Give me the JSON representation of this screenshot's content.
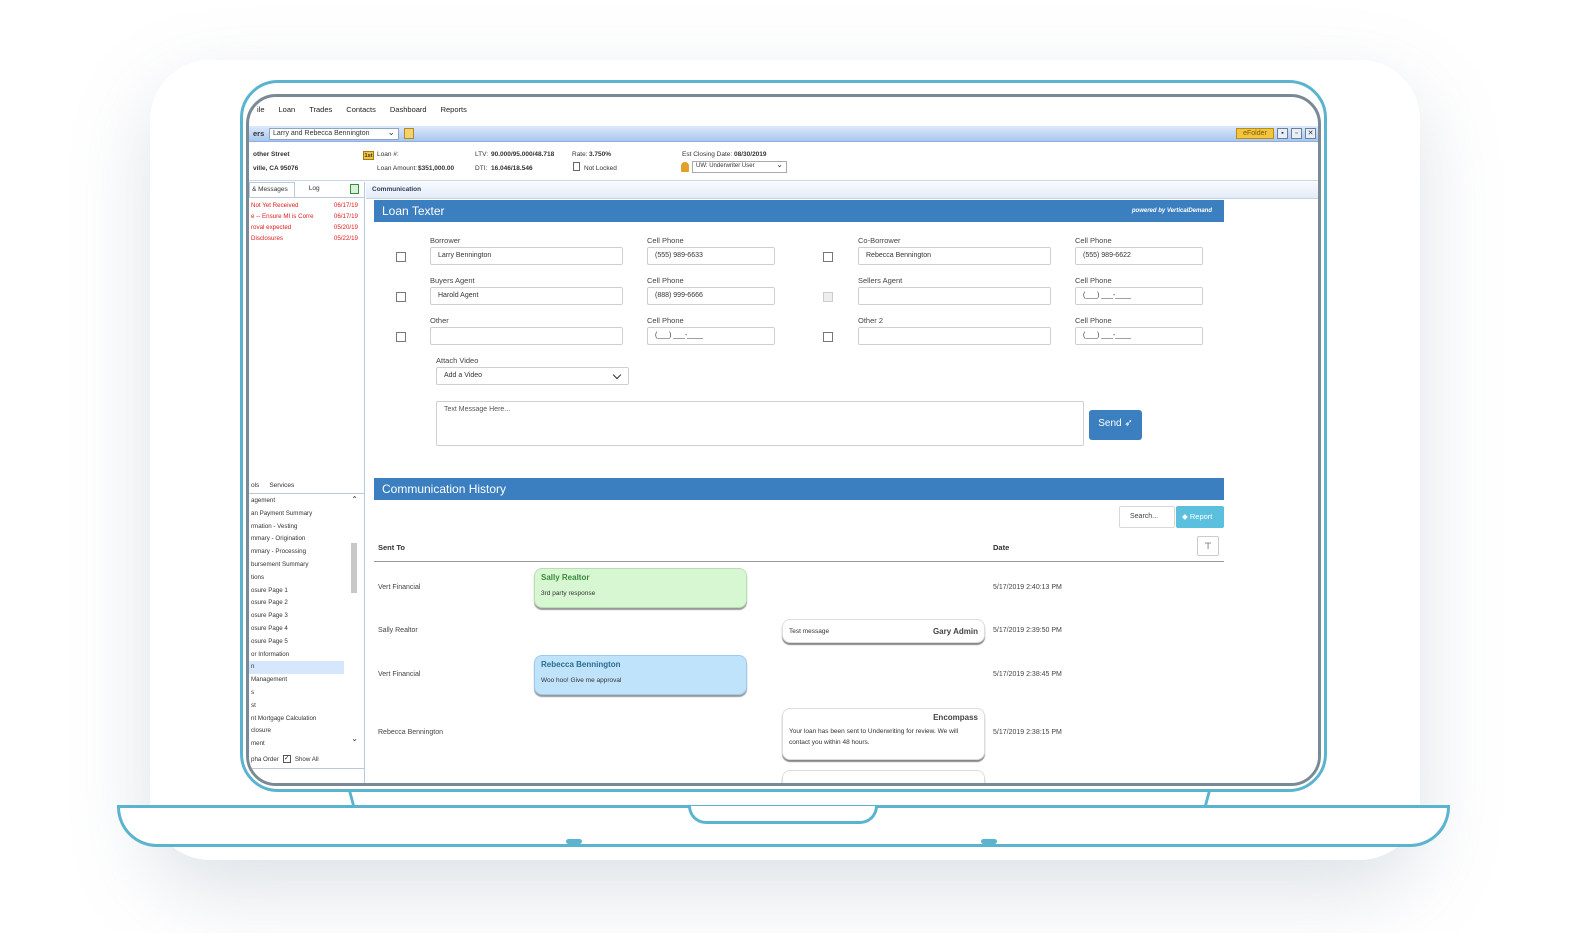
{
  "menu": [
    "ile",
    "Loan",
    "Trades",
    "Contacts",
    "Dashboard",
    "Reports"
  ],
  "titlebar": {
    "label": "ers",
    "borrower_select": "Larry and Rebecca Bennington",
    "efolder": "eFolder"
  },
  "info": {
    "street": "other Street",
    "city": "ville, CA 95076",
    "lien": "1st",
    "loan_num_label": "Loan #:",
    "loan_amount_label": "Loan Amount:",
    "loan_amount": "$351,000.00",
    "ltv_label": "LTV:",
    "ltv": "90.000/95.000/48.718",
    "dti_label": "DTI:",
    "dti": "16.046/18.546",
    "rate_label": "Rate:",
    "rate": "3.750%",
    "lock": "Not Locked",
    "closing_label": "Est Closing Date:",
    "closing_date": "08/30/2019",
    "underwriter": "UW: Underwriter User"
  },
  "left": {
    "tabs": [
      "& Messages",
      "Log"
    ],
    "messages": [
      {
        "text": "Not Yet Received",
        "date": "06/17/19"
      },
      {
        "text": "e -- Ensure MI is Corre",
        "date": "06/17/19"
      },
      {
        "text": "roval expected",
        "date": "05/20/19"
      },
      {
        "text": "Disclosures",
        "date": "05/22/19"
      }
    ],
    "tabs2": [
      "ols",
      "Services"
    ],
    "nav": [
      "agement",
      "an Payment Summary",
      "rmation - Vesting",
      "mmary - Origination",
      "mmary - Processing",
      "bursement Summary",
      "tions",
      "osure Page 1",
      "osure Page 2",
      "osure Page 3",
      "osure Page 4",
      "osure Page 5",
      "or Information",
      "n",
      "Management",
      "s",
      "st",
      "nt Mortgage Calculation",
      "closure",
      "ment"
    ],
    "alpha_order": "pha Order",
    "show_all": "Show All"
  },
  "main": {
    "tab": "Communication",
    "texter_title": "Loan Texter",
    "powered_by": "powered by VerticalDemand",
    "borrower_label": "Borrower",
    "borrower": "Larry Bennington",
    "cell_label": "Cell Phone",
    "borrower_cell": "(555) 989-6633",
    "coborrower_label": "Co-Borrower",
    "coborrower": "Rebecca Bennington",
    "coborrower_cell": "(555) 989-6622",
    "buyers_agent_label": "Buyers Agent",
    "buyers_agent": "Harold Agent",
    "buyers_agent_cell": "(888) 999-6666",
    "sellers_agent_label": "Sellers Agent",
    "empty_phone": "(___) ___-____",
    "other_label": "Other",
    "other2_label": "Other 2",
    "attach_video_label": "Attach Video",
    "add_video": "Add a Video",
    "text_placeholder": "Text Message Here...",
    "send": "Send",
    "history_title": "Communication History",
    "search": "Search...",
    "report": "Report",
    "col_sent_to": "Sent To",
    "col_date": "Date",
    "rows": [
      {
        "sent_to": "Vert Financial",
        "name": "Sally Realtor",
        "msg": "3rd party response",
        "date": "5/17/2019 2:40:13 PM"
      },
      {
        "sent_to": "Sally Realtor",
        "name": "Gary Admin",
        "msg": "Test message",
        "date": "5/17/2019 2:39:50 PM"
      },
      {
        "sent_to": "Vert Financial",
        "name": "Rebecca Bennington",
        "msg": "Woo hoo! Give me approval",
        "date": "5/17/2019 2:38:45 PM"
      },
      {
        "sent_to": "Rebecca Bennington",
        "name": "Encompass",
        "msg": "Your loan has been sent to Underwriting for review. We will contact you within 48 hours.",
        "date": "5/17/2019 2:38:15 PM"
      }
    ]
  }
}
